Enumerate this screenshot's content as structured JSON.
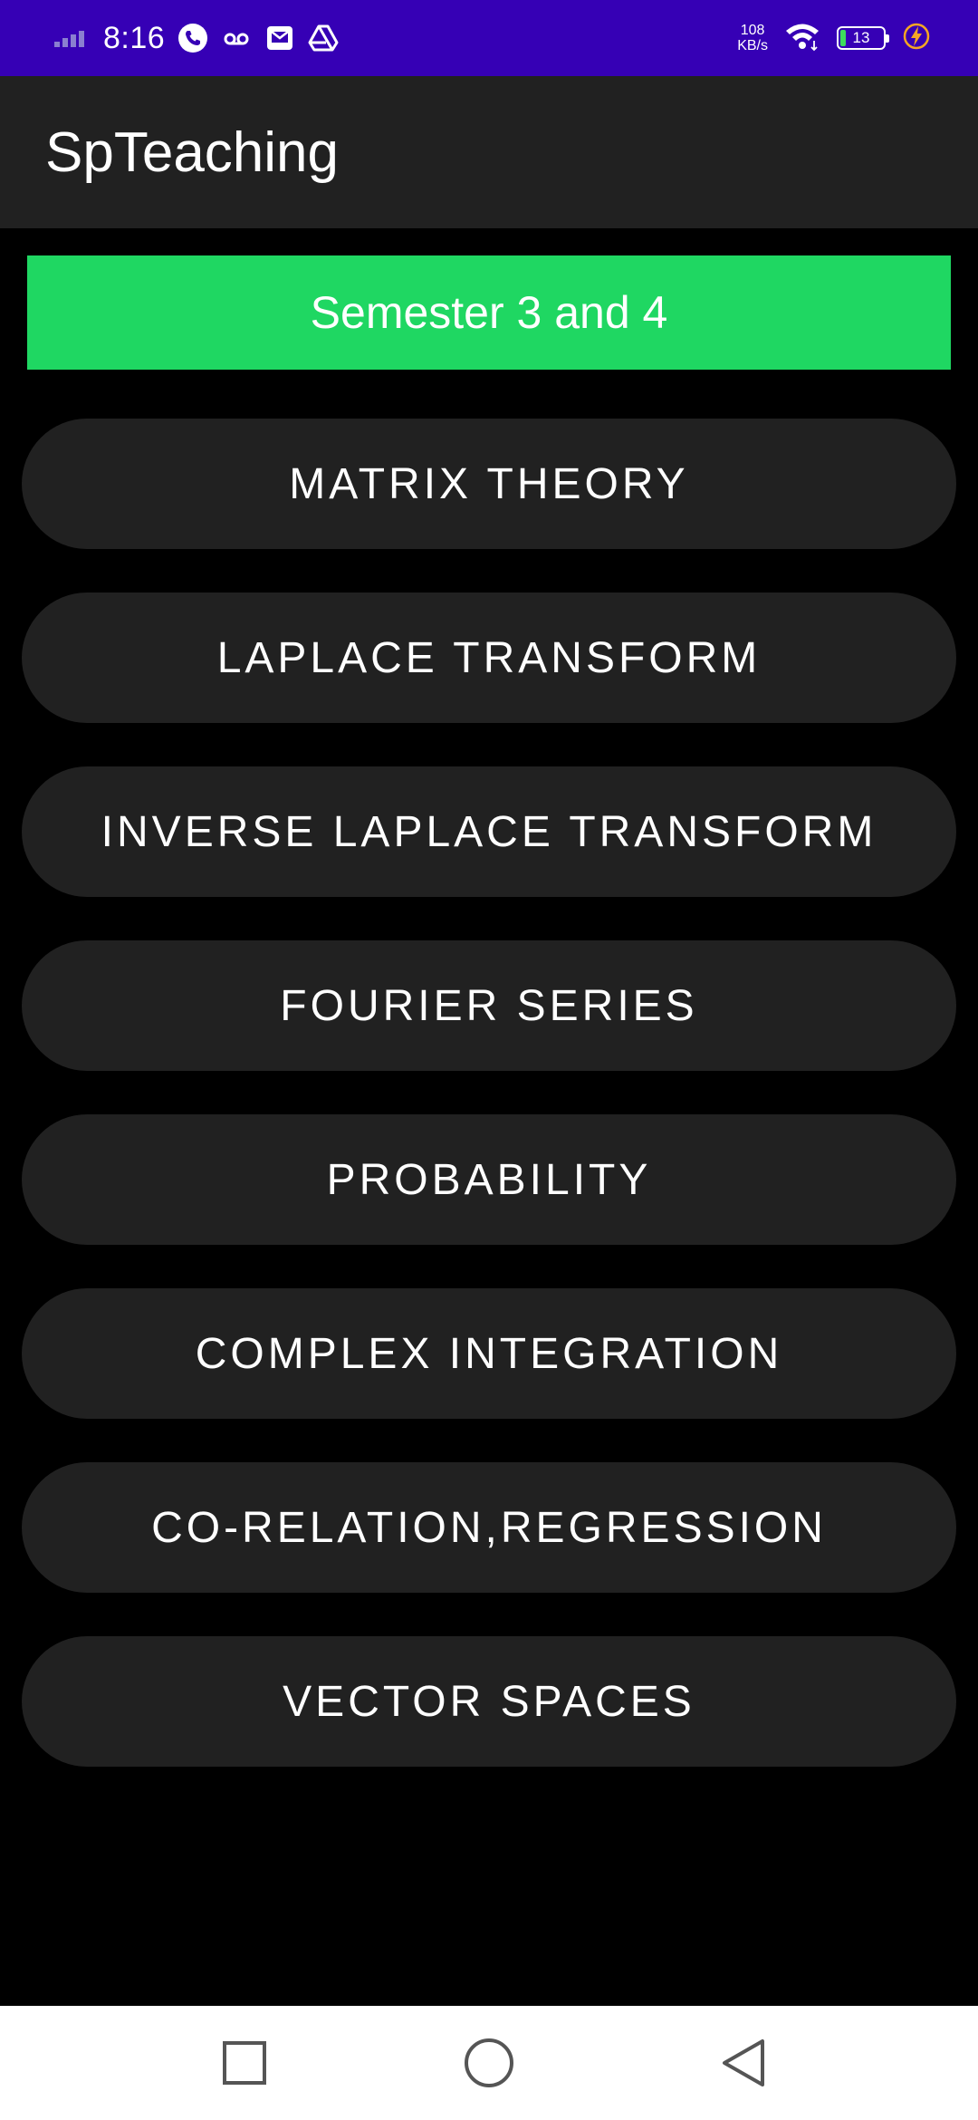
{
  "status_bar": {
    "time": "8:16",
    "net_speed_value": "108",
    "net_speed_unit": "KB/s",
    "battery_level": "13",
    "battery_fraction": 0.13,
    "icons": [
      "signal-icon",
      "phone-icon",
      "voicemail-icon",
      "message-icon",
      "drive-icon",
      "wifi-icon",
      "battery-icon",
      "charging-icon"
    ]
  },
  "app_bar": {
    "title": "SpTeaching"
  },
  "banner": {
    "label": "Semester 3 and 4",
    "color": "#1FD762"
  },
  "topics": [
    {
      "label": "MATRIX THEORY"
    },
    {
      "label": "LAPLACE TRANSFORM"
    },
    {
      "label": "INVERSE LAPLACE TRANSFORM"
    },
    {
      "label": "FOURIER SERIES"
    },
    {
      "label": "PROBABILITY"
    },
    {
      "label": "COMPLEX INTEGRATION"
    },
    {
      "label": "CO-RELATION,REGRESSION"
    },
    {
      "label": "VECTOR SPACES"
    }
  ],
  "nav_bar": {
    "icons": [
      "recents-square-icon",
      "home-circle-icon",
      "back-triangle-icon"
    ]
  },
  "colors": {
    "status_bar": "#3600B5",
    "app_bar": "#212121",
    "background": "#000000",
    "button": "#212121",
    "battery_fill": "#3ddc5c",
    "charging_bolt": "#F5A623"
  }
}
